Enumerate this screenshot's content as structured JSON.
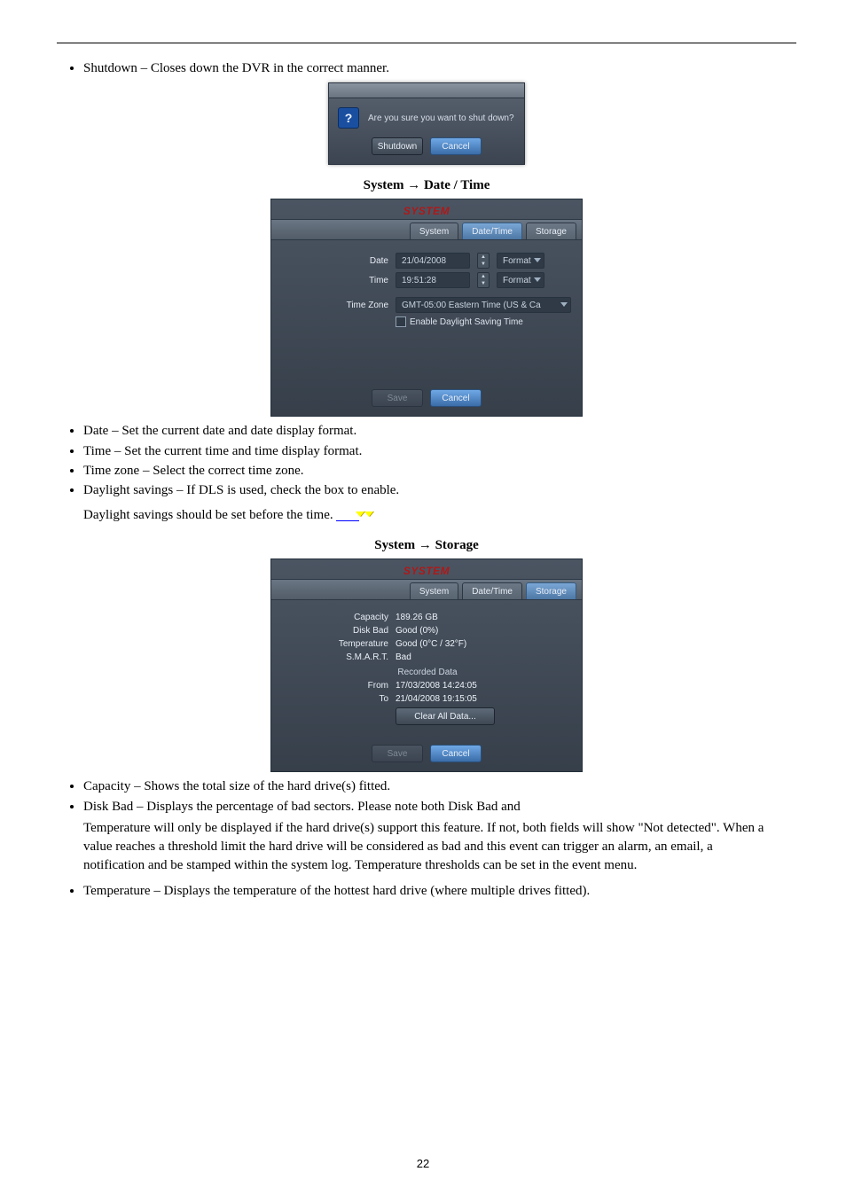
{
  "page_number": "22",
  "rule_present": true,
  "bullet_shutdown": "Shutdown – Closes down the DVR in the correct manner.",
  "fig_shutdown": {
    "message": "Are you sure you want to shut down?",
    "btn_shutdown": "Shutdown",
    "btn_cancel": "Cancel"
  },
  "datetime_heading_prefix": "System ",
  "arrow_glyph": "→",
  "datetime_heading_suffix": " Date / Time",
  "fig_datetime": {
    "title": "SYSTEM",
    "tab_system": "System",
    "tab_datetime": "Date/Time",
    "tab_storage": "Storage",
    "label_date": "Date",
    "value_date": "21/04/2008",
    "label_time": "Time",
    "value_time": "19:51:28",
    "format_label": "Format",
    "label_tz": "Time Zone",
    "value_tz": "GMT-05:00  Eastern Time (US & Ca",
    "dst_label": "Enable Daylight Saving Time",
    "btn_save": "Save",
    "btn_cancel": "Cancel"
  },
  "bullets_datetime": [
    "Date – Set the current date and date display format.",
    "Time – Set the current time and time display format.",
    "Time zone – Select the correct time zone.",
    "Daylight savings – If DLS is used, check the box to enable."
  ],
  "dst_note_prefix": "Daylight savings should be set before the time. ",
  "dst_note_hl": "",
  "storage_heading_prefix": "System ",
  "storage_heading_suffix": " Storage",
  "fig_storage": {
    "title": "SYSTEM",
    "tab_system": "System",
    "tab_datetime": "Date/Time",
    "tab_storage": "Storage",
    "label_capacity": "Capacity",
    "value_capacity": "189.26 GB",
    "label_diskbad": "Disk Bad",
    "value_diskbad": "Good (0%)",
    "label_temp": "Temperature",
    "value_temp": "Good (0°C / 32°F)",
    "label_smart": "S.M.A.R.T.",
    "value_smart": "Bad",
    "recorded_data": "Recorded Data",
    "label_from": "From",
    "value_from": "17/03/2008  14:24:05",
    "label_to": "To",
    "value_to": "21/04/2008  19:15:05",
    "btn_clear": "Clear All Data...",
    "btn_save": "Save",
    "btn_cancel": "Cancel"
  },
  "bullets_storage_top": [
    "Capacity – Shows the total size of the hard drive(s) fitted."
  ],
  "bullet_diskbad_line1": "Disk Bad – Displays the percentage of bad sectors. Please note both Disk Bad and",
  "bullet_diskbad_line2": "Temperature will only be displayed if the hard drive(s) support this feature. If not, both fields will show \"Not detected\". When a value reaches a threshold limit the hard drive will be considered as bad and this event can trigger an alarm, an email, a notification and be stamped within the system log. Temperature thresholds can be set in the event menu.",
  "bullet_temp": "Temperature – Displays the temperature of the hottest hard drive (where multiple drives fitted)."
}
